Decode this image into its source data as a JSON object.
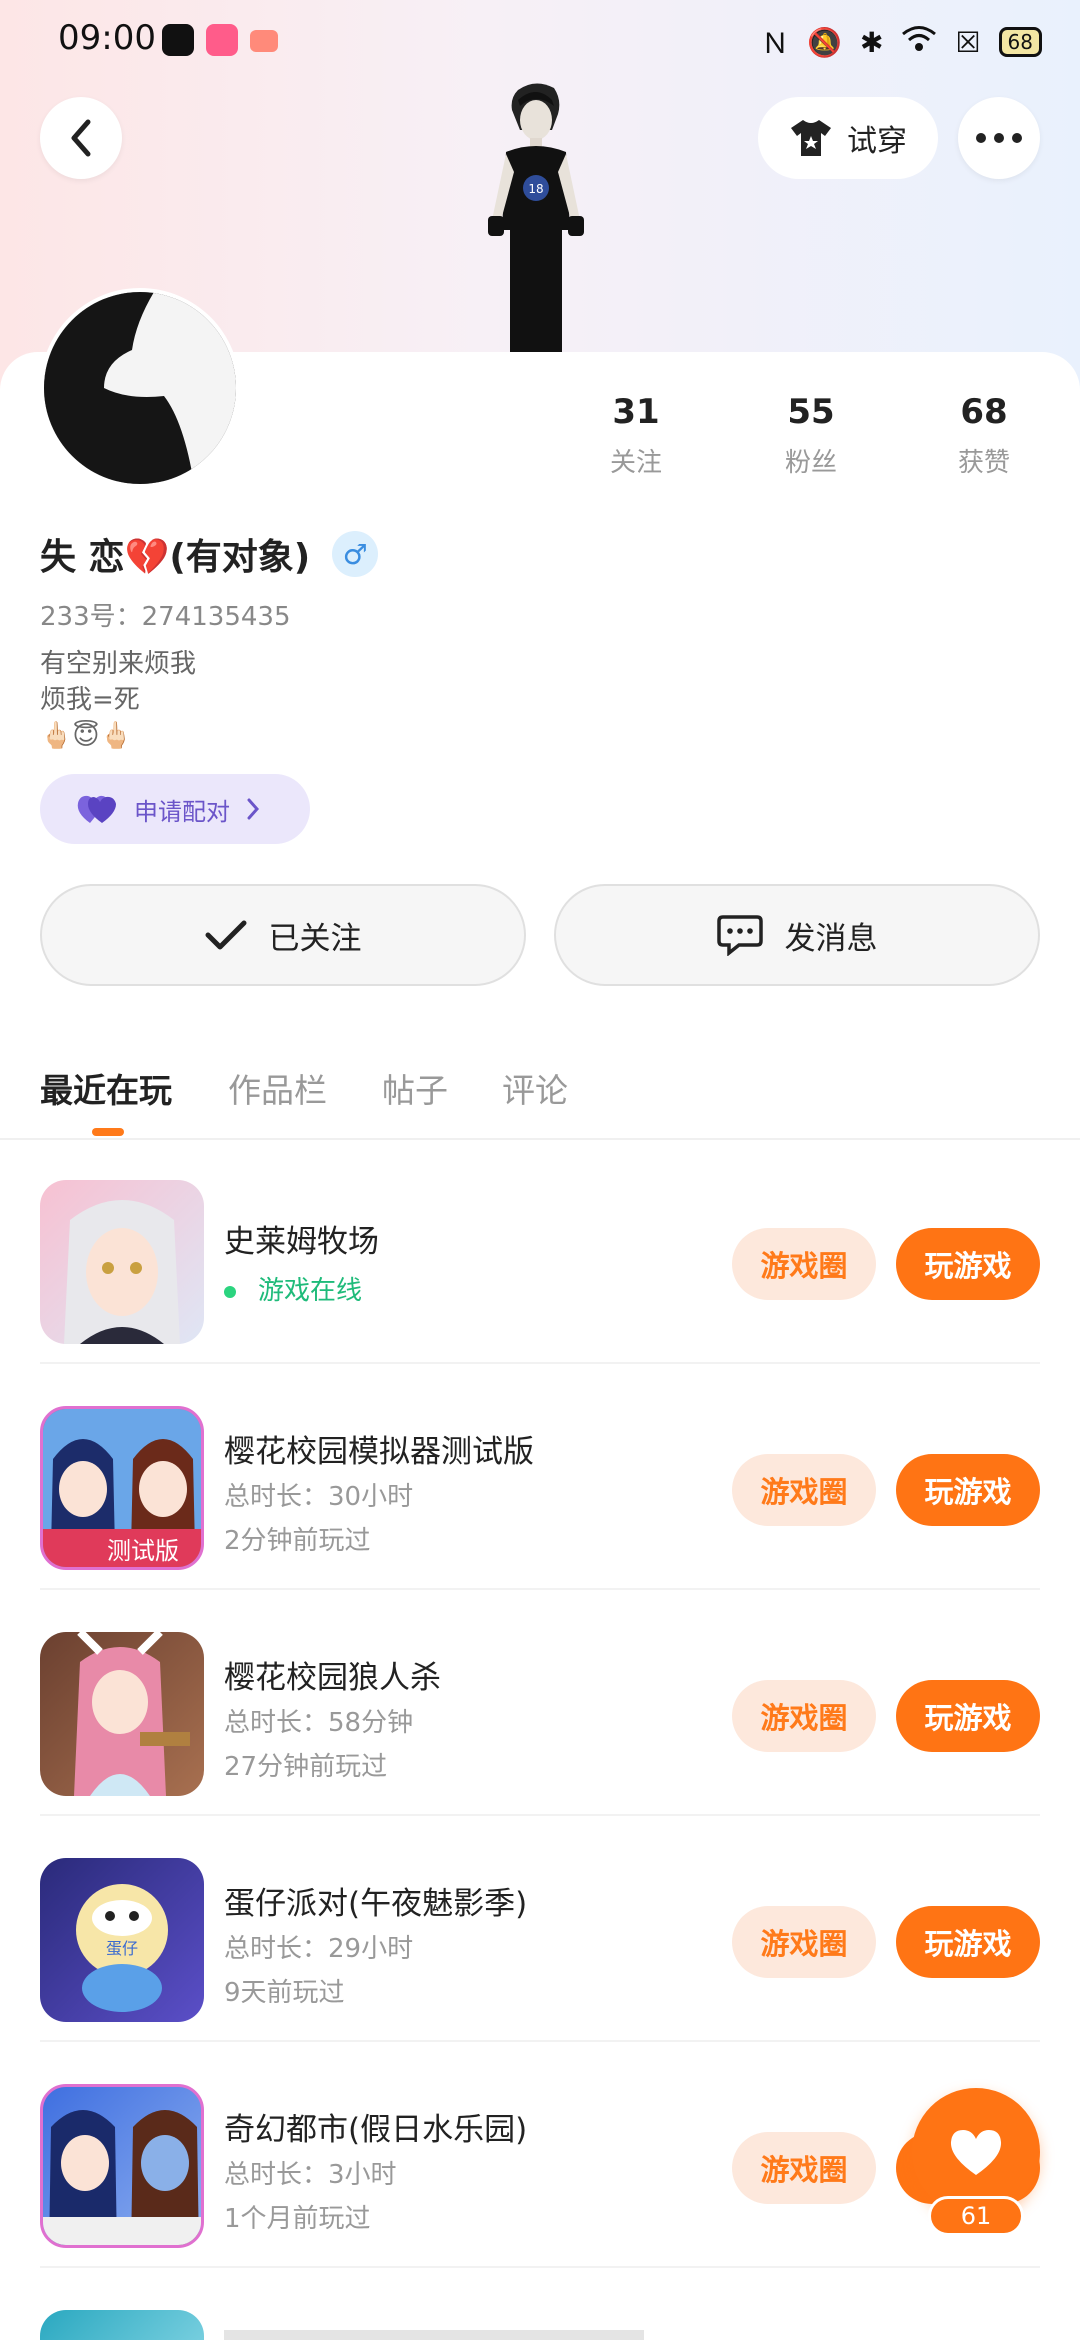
{
  "status_bar": {
    "time": "09:00",
    "battery": "68"
  },
  "header": {
    "tryon_label": "试穿"
  },
  "profile": {
    "nickname": "失  恋💔(有对象)",
    "gender_symbol": "♂",
    "uid": "233号：274135435",
    "bio": [
      "有空别来烦我",
      "烦我=死",
      "🖕🏻😇🖕🏻"
    ],
    "pair_label": "申请配对",
    "stats": [
      {
        "value": "31",
        "label": "关注"
      },
      {
        "value": "55",
        "label": "粉丝"
      },
      {
        "value": "68",
        "label": "获赞"
      }
    ],
    "follow_label": "已关注",
    "message_label": "发消息"
  },
  "tabs": [
    {
      "label": "最近在玩"
    },
    {
      "label": "作品栏"
    },
    {
      "label": "帖子"
    },
    {
      "label": "评论"
    }
  ],
  "games": [
    {
      "title": "史莱姆牧场",
      "line1": "游戏在线",
      "line2": "",
      "circle_label": "游戏圈",
      "play_label": "玩游戏",
      "icon_color": "#f5b8c8"
    },
    {
      "title": "樱花校园模拟器测试版",
      "line1": "总时长：30小时",
      "line2": "2分钟前玩过",
      "circle_label": "游戏圈",
      "play_label": "玩游戏",
      "icon_color": "#d94a78"
    },
    {
      "title": "樱花校园狼人杀",
      "line1": "总时长：58分钟",
      "line2": "27分钟前玩过",
      "circle_label": "游戏圈",
      "play_label": "玩游戏",
      "icon_color": "#8a5a3c"
    },
    {
      "title": "蛋仔派对(午夜魅影季)",
      "line1": "总时长：29小时",
      "line2": "9天前玩过",
      "circle_label": "游戏圈",
      "play_label": "玩游戏",
      "icon_color": "#3b3fa8"
    },
    {
      "title": "奇幻都市(假日水乐园)",
      "line1": "总时长：3小时",
      "line2": "1个月前玩过",
      "circle_label": "游戏圈",
      "play_label": "玩游戏",
      "icon_color": "#4f6fd6"
    }
  ],
  "fab": {
    "count": "61"
  }
}
